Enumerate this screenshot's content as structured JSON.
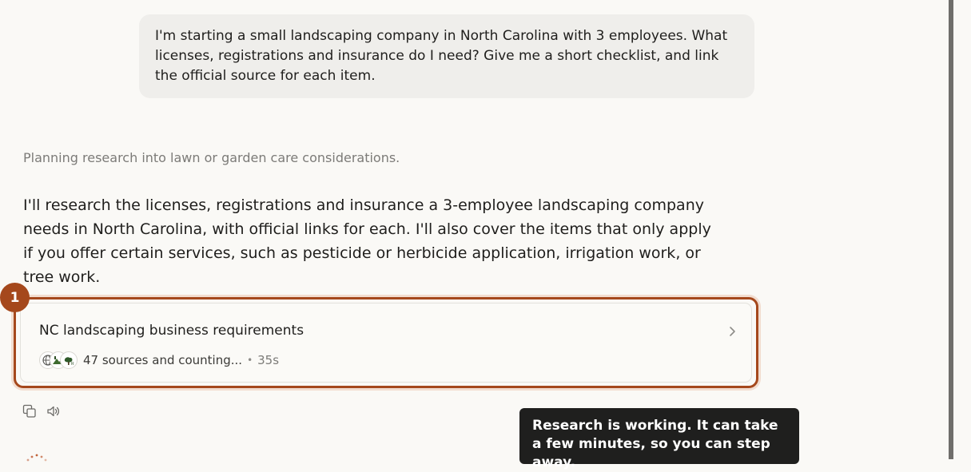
{
  "conversation": {
    "user_message": "I'm starting a small landscaping company in North Carolina with 3 employees. What licenses, registrations and insurance do I need? Give me a short checklist, and link the official source for each item.",
    "status_text": "Planning research into lawn or garden care considerations.",
    "assistant_reply": "I'll research the licenses, registrations and insurance a 3-employee landscaping company needs in North Carolina, with official links for each. I'll also cover the items that only apply if you offer certain services, such as pesticide or herbicide application, irrigation work, or tree work."
  },
  "research_card": {
    "badge": "1",
    "title": "NC landscaping business requirements",
    "sources_text": "47 sources and counting...",
    "separator": "•",
    "elapsed": "35s",
    "favicons": [
      "globe-icon",
      "landscape-icon",
      "tree-icon"
    ]
  },
  "toast": {
    "message": "Research is working. It can take a few minutes, so you can step away."
  },
  "colors": {
    "accent": "#a5481c",
    "background": "#faf9f6",
    "bubble": "#efeeeb",
    "toast_bg": "#1f1f1e"
  }
}
